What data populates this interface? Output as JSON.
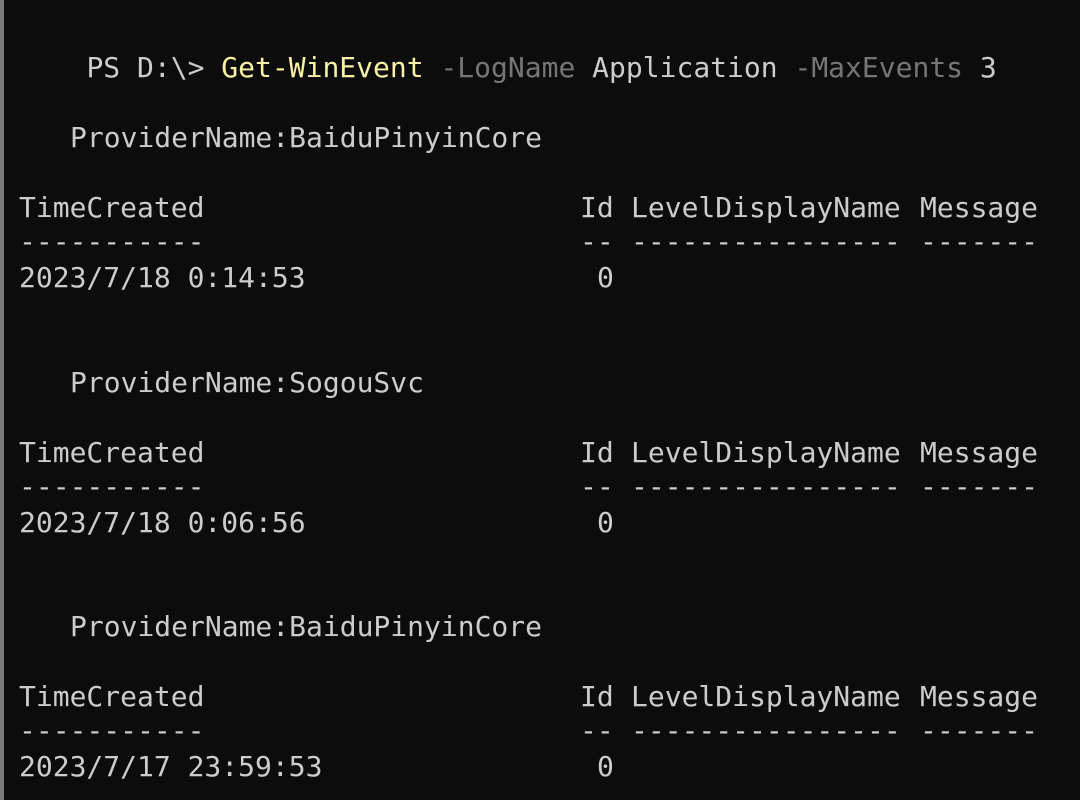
{
  "command": {
    "prompt": "PS D:\\> ",
    "cmdlet": "Get-WinEvent",
    "param1": "-LogName",
    "arg1": "Application",
    "param2": "-MaxEvents",
    "arg2": "3"
  },
  "columns": {
    "time": "TimeCreated",
    "id": "Id",
    "level": "LevelDisplayName",
    "message": "Message"
  },
  "separators": {
    "time": "-----------",
    "id": "--",
    "level": "----------------",
    "message": "-------"
  },
  "groups": [
    {
      "provider_label": "ProviderName:BaiduPinyinCore",
      "rows": [
        {
          "time": "2023/7/18 0:14:53",
          "id": "0",
          "level": "",
          "message": ""
        }
      ]
    },
    {
      "provider_label": "ProviderName:SogouSvc",
      "rows": [
        {
          "time": "2023/7/18 0:06:56",
          "id": "0",
          "level": "",
          "message": ""
        }
      ]
    },
    {
      "provider_label": "ProviderName:BaiduPinyinCore",
      "rows": [
        {
          "time": "2023/7/17 23:59:53",
          "id": "0",
          "level": "",
          "message": ""
        }
      ]
    }
  ],
  "colors": {
    "background": "#0c0c0c",
    "text": "#cccccc",
    "cmdlet": "#f9f1a5",
    "parameter": "#767676"
  }
}
